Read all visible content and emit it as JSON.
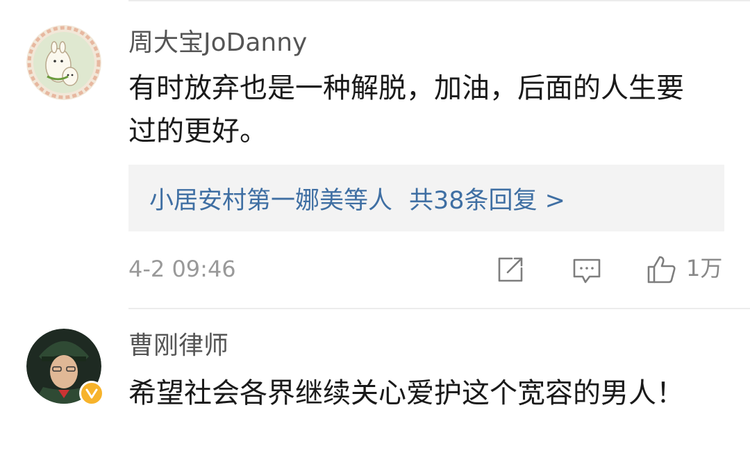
{
  "comments": [
    {
      "username": "周大宝JoDanny",
      "text": "有时放弃也是一种解脱，加油，后面的人生要过的更好。",
      "replies": {
        "names": "小居安村第一娜美等人",
        "count_label": "共38条回复 >"
      },
      "time": "4-2 09:46",
      "likes": "1万",
      "avatar_icon": "alpaca-cartoon-avatar"
    },
    {
      "username": "曹刚律师",
      "text": "希望社会各界继续关心爱护这个宽容的男人！",
      "verified": true,
      "verified_color": "#f7b32b",
      "avatar_icon": "man-in-uniform-avatar"
    }
  ],
  "icons": {
    "share": "share-icon",
    "comment": "comment-icon",
    "like": "thumbs-up-icon"
  },
  "colors": {
    "link": "#3f6fa3",
    "meta": "#999999",
    "reply_bg": "#f3f3f3"
  }
}
